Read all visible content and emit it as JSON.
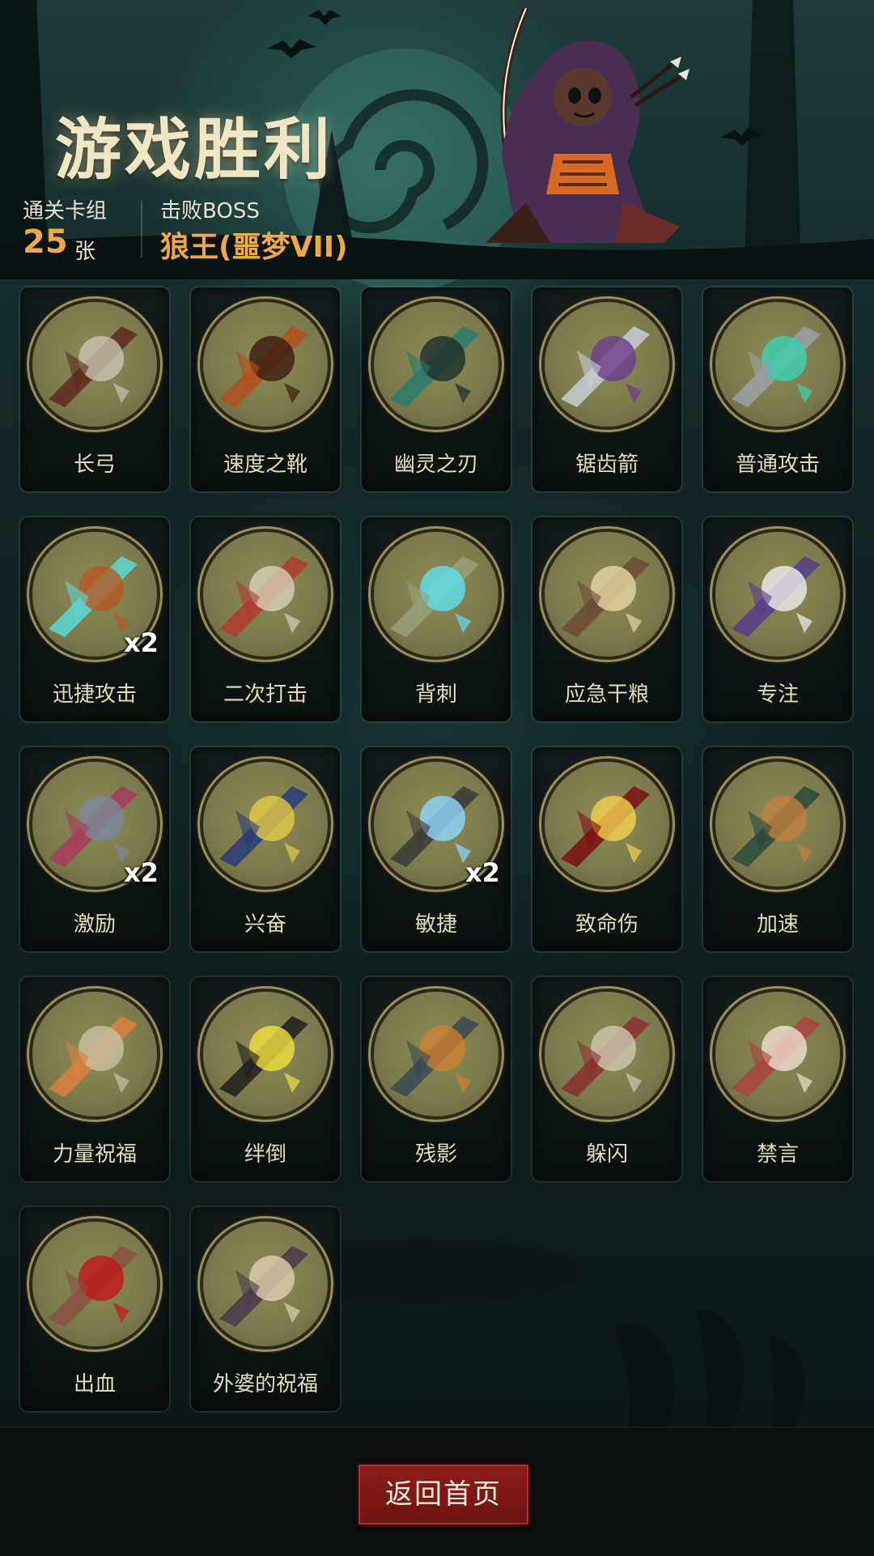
{
  "header": {
    "title": "游戏胜利",
    "deck_label": "通关卡组",
    "deck_count": "25",
    "deck_unit": "张",
    "boss_label": "击败BOSS",
    "boss_name": "狼王(噩梦VII)"
  },
  "cards": [
    {
      "label": "长弓",
      "icon": "longbow-icon"
    },
    {
      "label": "速度之靴",
      "icon": "speed-boots-icon"
    },
    {
      "label": "幽灵之刃",
      "icon": "ghost-blade-icon"
    },
    {
      "label": "锯齿箭",
      "icon": "serrated-arrow-icon"
    },
    {
      "label": "普通攻击",
      "icon": "normal-attack-icon"
    },
    {
      "label": "迅捷攻击",
      "icon": "swift-attack-icon",
      "badge": "x2"
    },
    {
      "label": "二次打击",
      "icon": "double-strike-icon"
    },
    {
      "label": "背刺",
      "icon": "backstab-icon"
    },
    {
      "label": "应急干粮",
      "icon": "emergency-rations-icon"
    },
    {
      "label": "专注",
      "icon": "focus-icon"
    },
    {
      "label": "激励",
      "icon": "inspire-icon",
      "badge": "x2"
    },
    {
      "label": "兴奋",
      "icon": "excite-icon"
    },
    {
      "label": "敏捷",
      "icon": "agility-icon",
      "badge": "x2"
    },
    {
      "label": "致命伤",
      "icon": "fatal-wound-icon"
    },
    {
      "label": "加速",
      "icon": "haste-icon"
    },
    {
      "label": "力量祝福",
      "icon": "strength-blessing-icon"
    },
    {
      "label": "绊倒",
      "icon": "trip-icon"
    },
    {
      "label": "残影",
      "icon": "afterimage-icon"
    },
    {
      "label": "躲闪",
      "icon": "dodge-icon"
    },
    {
      "label": "禁言",
      "icon": "silence-icon"
    },
    {
      "label": "出血",
      "icon": "bleed-icon"
    },
    {
      "label": "外婆的祝福",
      "icon": "grandma-blessing-icon"
    }
  ],
  "footer": {
    "back_button": "返回首页"
  },
  "colors": {
    "accent": "#f0a93f",
    "button": "#8e1d1a",
    "card_text": "#e6dbb8"
  }
}
